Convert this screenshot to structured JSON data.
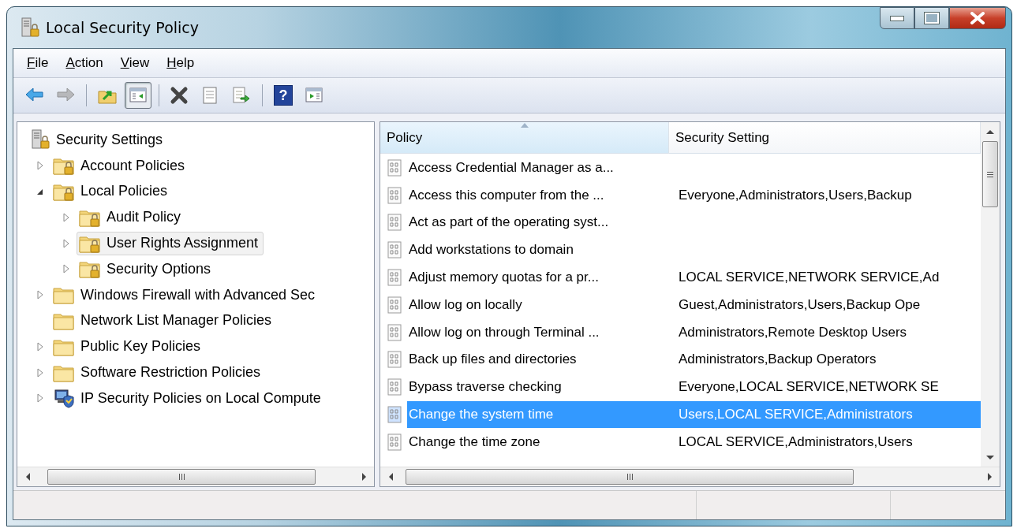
{
  "window": {
    "title": "Local Security Policy"
  },
  "menu": [
    {
      "key": "F",
      "rest": "ile"
    },
    {
      "key": "A",
      "rest": "ction"
    },
    {
      "key": "V",
      "rest": "iew"
    },
    {
      "key": "H",
      "rest": "elp"
    }
  ],
  "toolbar": [
    {
      "kind": "back",
      "disabled": false,
      "pressed": false
    },
    {
      "kind": "forward",
      "disabled": true,
      "pressed": false
    },
    {
      "kind": "separator"
    },
    {
      "kind": "up",
      "disabled": false,
      "pressed": false
    },
    {
      "kind": "tree-toggle",
      "disabled": false,
      "pressed": true
    },
    {
      "kind": "separator"
    },
    {
      "kind": "delete",
      "disabled": false,
      "pressed": false
    },
    {
      "kind": "properties",
      "disabled": false,
      "pressed": false
    },
    {
      "kind": "export",
      "disabled": false,
      "pressed": false
    },
    {
      "kind": "separator"
    },
    {
      "kind": "help",
      "glyph": "?",
      "disabled": false,
      "pressed": false
    },
    {
      "kind": "action-toggle",
      "disabled": false,
      "pressed": false
    }
  ],
  "tree": [
    {
      "label": "Security Settings",
      "kind": "root",
      "expandable": false,
      "selected": false,
      "children": [
        {
          "label": "Account Policies",
          "kind": "locked",
          "expandable": true,
          "expanded": false,
          "selected": false
        },
        {
          "label": "Local Policies",
          "kind": "locked",
          "expandable": true,
          "expanded": true,
          "selected": false,
          "children": [
            {
              "label": "Audit Policy",
              "kind": "locked",
              "expandable": true,
              "expanded": false,
              "selected": false
            },
            {
              "label": "User Rights Assignment",
              "kind": "locked",
              "expandable": true,
              "expanded": false,
              "selected": true
            },
            {
              "label": "Security Options",
              "kind": "locked",
              "expandable": true,
              "expanded": false,
              "selected": false
            }
          ]
        },
        {
          "label": "Windows Firewall with Advanced Sec",
          "kind": "folder",
          "expandable": true,
          "expanded": false,
          "selected": false
        },
        {
          "label": "Network List Manager Policies",
          "kind": "folder",
          "expandable": false,
          "selected": false
        },
        {
          "label": "Public Key Policies",
          "kind": "folder",
          "expandable": true,
          "expanded": false,
          "selected": false
        },
        {
          "label": "Software Restriction Policies",
          "kind": "folder",
          "expandable": true,
          "expanded": false,
          "selected": false
        },
        {
          "label": "IP Security Policies on Local Compute",
          "kind": "network",
          "expandable": true,
          "expanded": false,
          "selected": false
        }
      ]
    }
  ],
  "table": {
    "columns": [
      {
        "label": "Policy",
        "sorted": true
      },
      {
        "label": "Security Setting",
        "sorted": false
      }
    ],
    "rows": [
      {
        "policy": "Access Credential Manager as a...",
        "setting": "",
        "selected": false
      },
      {
        "policy": "Access this computer from the ...",
        "setting": "Everyone,Administrators,Users,Backup",
        "selected": false
      },
      {
        "policy": "Act as part of the operating syst...",
        "setting": "",
        "selected": false
      },
      {
        "policy": "Add workstations to domain",
        "setting": "",
        "selected": false
      },
      {
        "policy": "Adjust memory quotas for a pr...",
        "setting": "LOCAL SERVICE,NETWORK SERVICE,Ad",
        "selected": false
      },
      {
        "policy": "Allow log on locally",
        "setting": "Guest,Administrators,Users,Backup Ope",
        "selected": false
      },
      {
        "policy": "Allow log on through Terminal ...",
        "setting": "Administrators,Remote Desktop Users",
        "selected": false
      },
      {
        "policy": "Back up files and directories",
        "setting": "Administrators,Backup Operators",
        "selected": false
      },
      {
        "policy": "Bypass traverse checking",
        "setting": "Everyone,LOCAL SERVICE,NETWORK SE",
        "selected": false
      },
      {
        "policy": "Change the system time",
        "setting": "Users,LOCAL SERVICE,Administrators",
        "selected": true
      },
      {
        "policy": "Change the time zone",
        "setting": "LOCAL SERVICE,Administrators,Users",
        "selected": false
      }
    ]
  }
}
